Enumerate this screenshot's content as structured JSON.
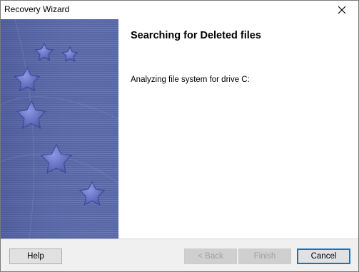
{
  "window": {
    "title": "Recovery Wizard"
  },
  "icons": {
    "close": "close-icon",
    "decoration": "stars-illustration"
  },
  "content": {
    "heading": "Searching for Deleted files",
    "status": "Analyzing file system for drive C:"
  },
  "buttons": {
    "help": "Help",
    "back": "< Back",
    "finish": "Finish",
    "cancel": "Cancel"
  },
  "colors": {
    "panel": "#5a6aa8",
    "star": "#6f7fcf",
    "accent": "#0078d7"
  }
}
